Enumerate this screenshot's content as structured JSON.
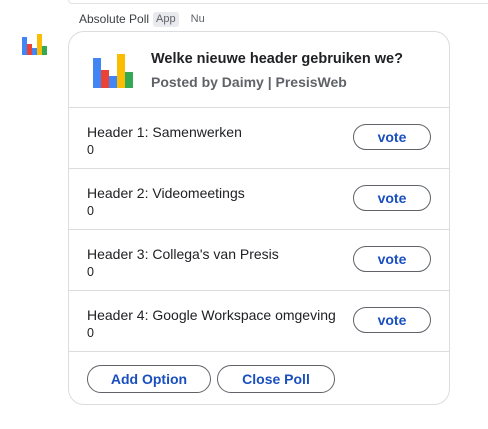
{
  "message": {
    "sender": "Absolute Poll",
    "badge": "App",
    "time": "Nu"
  },
  "poll": {
    "title": "Welke nieuwe header gebruiken we?",
    "subtitle": "Posted by Daimy | PresisWeb",
    "vote_label": "vote",
    "options": [
      {
        "label": "Header 1: Samenwerken",
        "count": "0"
      },
      {
        "label": "Header 2: Videomeetings",
        "count": "0"
      },
      {
        "label": "Header 3: Collega's van Presis",
        "count": "0"
      },
      {
        "label": "Header 4: Google Workspace omgeving",
        "count": "0"
      }
    ],
    "add_option_label": "Add Option",
    "close_poll_label": "Close Poll"
  },
  "logo_colors": [
    "#4285f4",
    "#ea4335",
    "#fbbc04",
    "#34a853"
  ]
}
